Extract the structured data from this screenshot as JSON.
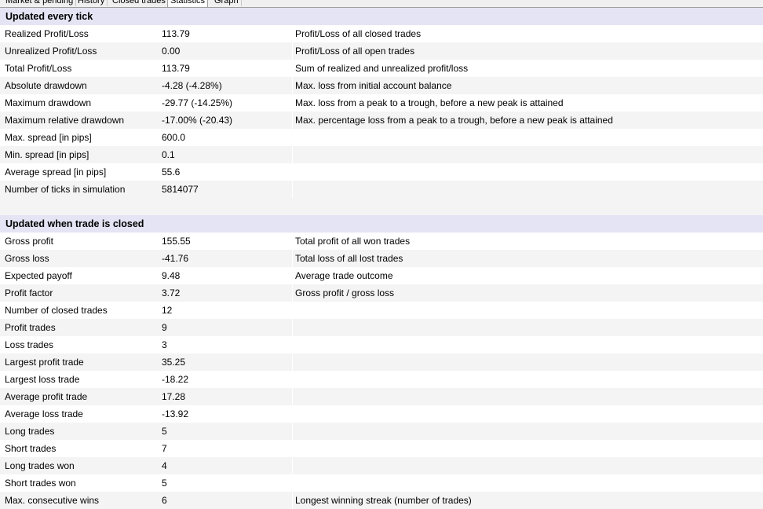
{
  "tabs": [
    {
      "label": "Market & pending"
    },
    {
      "label": "History"
    },
    {
      "label": "Closed trades"
    },
    {
      "label": "Statistics"
    },
    {
      "label": "Graph"
    }
  ],
  "active_tab": "Statistics",
  "sections": [
    {
      "title": "Updated every tick",
      "rows": [
        {
          "name": "Realized Profit/Loss",
          "value": "113.79",
          "description": "Profit/Loss of all closed trades"
        },
        {
          "name": "Unrealized Profit/Loss",
          "value": "0.00",
          "description": "Profit/Loss of all open trades"
        },
        {
          "name": "Total Profit/Loss",
          "value": "113.79",
          "description": "Sum of realized and unrealized profit/loss"
        },
        {
          "name": "Absolute drawdown",
          "value": "-4.28 (-4.28%)",
          "description": "Max. loss from initial account balance"
        },
        {
          "name": "Maximum drawdown",
          "value": "-29.77 (-14.25%)",
          "description": "Max. loss from a peak to a trough, before a new peak is attained"
        },
        {
          "name": "Maximum relative drawdown",
          "value": "-17.00% (-20.43)",
          "description": "Max. percentage loss from a peak to a trough, before a new peak is attained"
        },
        {
          "name": "Max. spread [in pips]",
          "value": "600.0",
          "description": ""
        },
        {
          "name": "Min. spread [in pips]",
          "value": "0.1",
          "description": ""
        },
        {
          "name": "Average spread [in pips]",
          "value": "55.6",
          "description": ""
        },
        {
          "name": "Number of ticks in simulation",
          "value": "5814077",
          "description": ""
        }
      ]
    },
    {
      "title": "Updated when trade is closed",
      "rows": [
        {
          "name": "Gross profit",
          "value": "155.55",
          "description": "Total profit of all won trades"
        },
        {
          "name": "Gross loss",
          "value": "-41.76",
          "description": "Total loss of all lost trades"
        },
        {
          "name": "Expected payoff",
          "value": "9.48",
          "description": "Average trade outcome"
        },
        {
          "name": "Profit factor",
          "value": "3.72",
          "description": "Gross profit / gross loss"
        },
        {
          "name": "Number of closed trades",
          "value": "12",
          "description": ""
        },
        {
          "name": "Profit trades",
          "value": "9",
          "description": ""
        },
        {
          "name": "Loss trades",
          "value": "3",
          "description": ""
        },
        {
          "name": "Largest profit trade",
          "value": "35.25",
          "description": ""
        },
        {
          "name": "Largest loss trade",
          "value": "-18.22",
          "description": ""
        },
        {
          "name": "Average profit trade",
          "value": "17.28",
          "description": ""
        },
        {
          "name": "Average loss trade",
          "value": "-13.92",
          "description": ""
        },
        {
          "name": "Long trades",
          "value": "5",
          "description": ""
        },
        {
          "name": "Short trades",
          "value": "7",
          "description": ""
        },
        {
          "name": "Long trades won",
          "value": "4",
          "description": ""
        },
        {
          "name": "Short trades won",
          "value": "5",
          "description": ""
        },
        {
          "name": "Max. consecutive wins",
          "value": "6",
          "description": "Longest winning streak (number of trades)"
        }
      ]
    }
  ],
  "colors": {
    "section_header_bg": "#e4e4f4",
    "row_alt_bg": "#f4f4f4",
    "tabbar_bg": "#f0f0f0"
  }
}
